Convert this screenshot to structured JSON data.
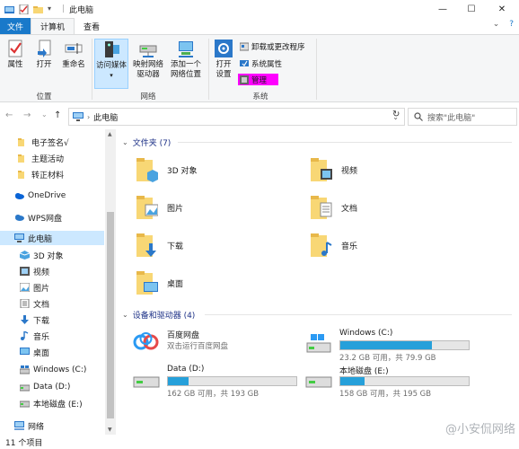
{
  "window": {
    "title": "此电脑",
    "minimize": "—",
    "maximize": "☐",
    "close": "✕"
  },
  "ribbon_tabs": {
    "file": "文件",
    "computer": "计算机",
    "view": "查看",
    "collapse": "⌄",
    "help": "?"
  },
  "ribbon": {
    "location": {
      "label": "位置",
      "properties": "属性",
      "open": "打开",
      "rename": "重命名"
    },
    "network": {
      "label": "网络",
      "access_media": "访问媒体",
      "map_drive_line1": "映射网络",
      "map_drive_line2": "驱动器",
      "add_location_line1": "添加一个",
      "add_location_line2": "网络位置"
    },
    "system": {
      "label": "系统",
      "open_settings_line1": "打开",
      "open_settings_line2": "设置",
      "uninstall": "卸载或更改程序",
      "system_properties": "系统属性",
      "manage": "管理"
    }
  },
  "navbar": {
    "back": "←",
    "forward": "→",
    "recent": "⌄",
    "up": "↑",
    "path": "此电脑",
    "refresh": "↻",
    "search_placeholder": "搜索\"此电脑\""
  },
  "nav_pane": {
    "items": [
      {
        "label": "电子签名√"
      },
      {
        "label": "主题活动"
      },
      {
        "label": "转正材料"
      },
      {
        "label": "OneDrive"
      },
      {
        "label": "WPS网盘"
      },
      {
        "label": "此电脑"
      },
      {
        "label": "3D 对象"
      },
      {
        "label": "视频"
      },
      {
        "label": "图片"
      },
      {
        "label": "文档"
      },
      {
        "label": "下载"
      },
      {
        "label": "音乐"
      },
      {
        "label": "桌面"
      },
      {
        "label": "Windows (C:)"
      },
      {
        "label": "Data (D:)"
      },
      {
        "label": "本地磁盘 (E:)"
      },
      {
        "label": "网络"
      }
    ]
  },
  "content": {
    "folders_header": "文件夹 (7)",
    "folders": [
      {
        "name": "3D 对象"
      },
      {
        "name": "视频"
      },
      {
        "name": "图片"
      },
      {
        "name": "文档"
      },
      {
        "name": "下载"
      },
      {
        "name": "音乐"
      },
      {
        "name": "桌面"
      }
    ],
    "devices_header": "设备和驱动器 (4)",
    "devices": [
      {
        "name": "百度网盘",
        "sub": "双击运行百度网盘"
      },
      {
        "name": "Windows (C:)",
        "sub": "23.2 GB 可用，共 79.9 GB",
        "used_fraction": 0.71
      },
      {
        "name": "Data (D:)",
        "sub": "162 GB 可用，共 193 GB",
        "used_fraction": 0.16
      },
      {
        "name": "本地磁盘 (E:)",
        "sub": "158 GB 可用，共 195 GB",
        "used_fraction": 0.19
      }
    ]
  },
  "status": {
    "count": "11 个项目"
  },
  "watermark": "@小安侃网络",
  "colors": {
    "accent": "#1979ca",
    "drive_fill": "#26a0da",
    "selection": "#cce8ff",
    "folder": "#f8d775",
    "manage_highlight": "#ff00ff"
  }
}
